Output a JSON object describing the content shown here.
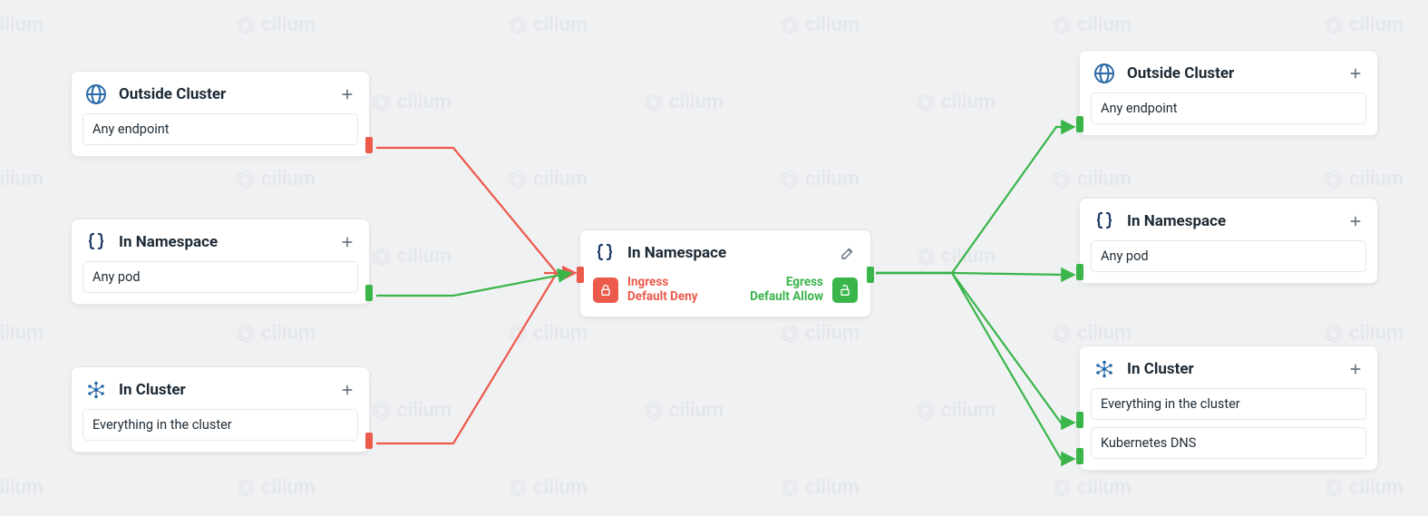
{
  "watermark": {
    "text": "cilium"
  },
  "colors": {
    "deny": "#ec5a4c",
    "allow": "#3ab54a"
  },
  "left": {
    "outsideCluster": {
      "title": "Outside Cluster",
      "rows": [
        "Any endpoint"
      ]
    },
    "inNamespace": {
      "title": "In Namespace",
      "rows": [
        "Any pod"
      ]
    },
    "inCluster": {
      "title": "In Cluster",
      "rows": [
        "Everything in the cluster"
      ]
    }
  },
  "center": {
    "title": "In Namespace",
    "ingress": {
      "label1": "Ingress",
      "label2": "Default Deny"
    },
    "egress": {
      "label1": "Egress",
      "label2": "Default Allow"
    }
  },
  "right": {
    "outsideCluster": {
      "title": "Outside Cluster",
      "rows": [
        "Any endpoint"
      ]
    },
    "inNamespace": {
      "title": "In Namespace",
      "rows": [
        "Any pod"
      ]
    },
    "inCluster": {
      "title": "In Cluster",
      "rows": [
        "Everything in the cluster",
        "Kubernetes DNS"
      ]
    }
  }
}
